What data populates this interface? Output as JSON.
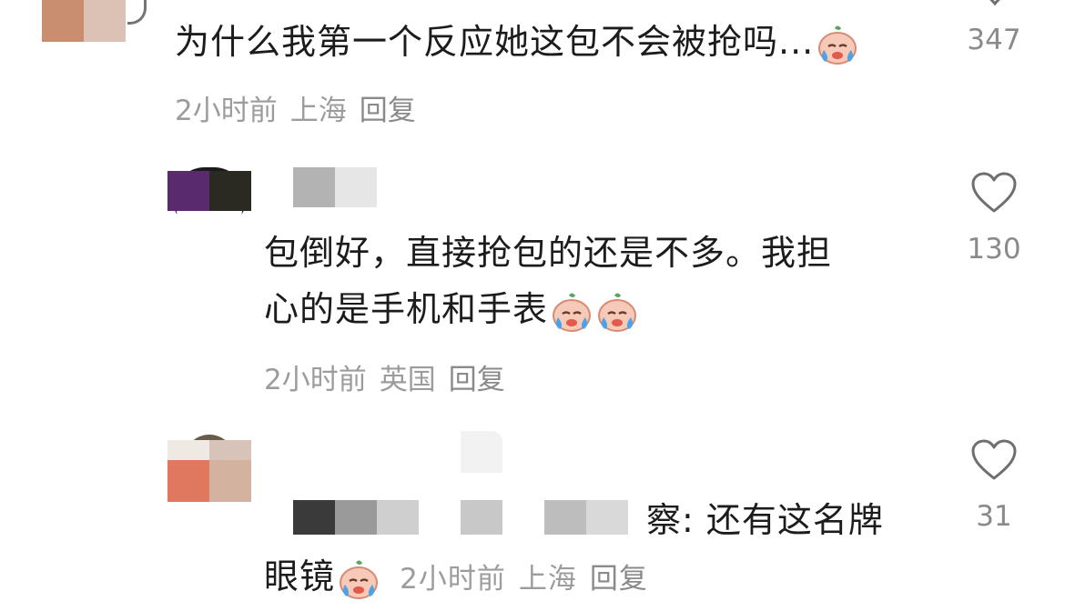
{
  "comments": [
    {
      "text": "为什么我第一个反应她这包不会被抢吗...",
      "emoji_count": 1,
      "emoji": "crying-face-emoji",
      "time": "2小时前",
      "location": "上海",
      "reply_label": "回复",
      "likes": "347"
    },
    {
      "text_line1": "包倒好，直接抢包的还是不多。我担",
      "text_line2": "心的是手机和手表",
      "emoji_count": 2,
      "emoji": "crying-face-emoji",
      "time": "2小时前",
      "location": "英国",
      "reply_label": "回复",
      "likes": "130"
    },
    {
      "text_tail": "察: 还有这名牌",
      "text_line2": "眼镜",
      "emoji_count": 1,
      "emoji": "crying-face-emoji",
      "time": "2小时前",
      "location": "上海",
      "reply_label": "回复",
      "likes": "31"
    }
  ],
  "colors": {
    "text": "#1c1c1c",
    "meta": "#9c9c9c",
    "count": "#8a8a8a",
    "heart_stroke": "#6f6f6f"
  }
}
